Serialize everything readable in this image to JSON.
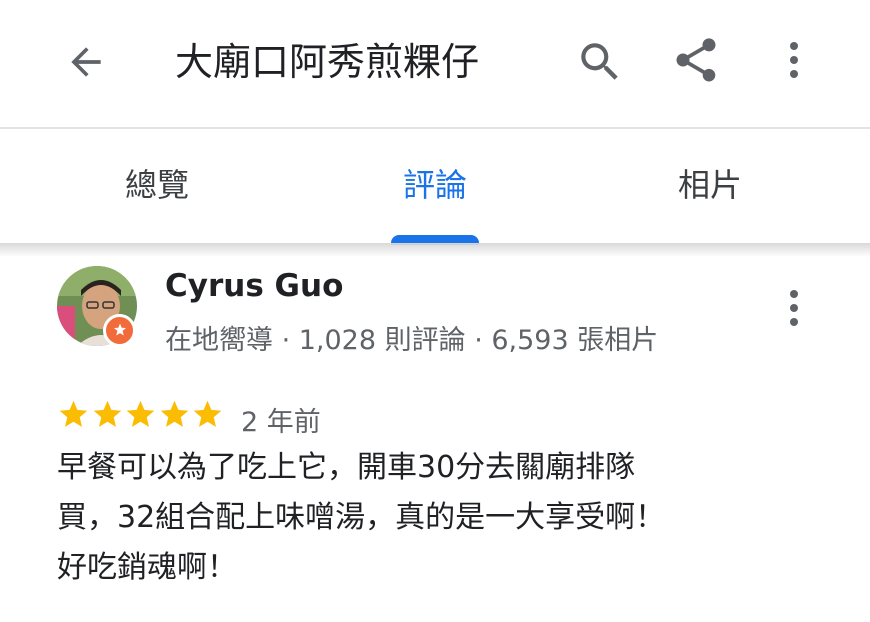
{
  "header": {
    "title": "大廟口阿秀煎粿仔",
    "back_icon": "arrow-back-icon",
    "search_icon": "search-icon",
    "share_icon": "share-icon",
    "more_icon": "more-vert-icon"
  },
  "tabs": [
    {
      "label": "總覽",
      "active": false
    },
    {
      "label": "評論",
      "active": true
    },
    {
      "label": "相片",
      "active": false
    }
  ],
  "review": {
    "author": "Cyrus Guo",
    "author_meta": "在地嚮導 · 1,028 則評論 · 6,593 張相片",
    "rating": 5,
    "rating_max": 5,
    "time_ago": "2 年前",
    "text_lines": [
      "早餐可以為了吃上它，開車30分去關廟排隊",
      "買，32組合配上味噌湯，真的是一大享受啊！",
      "好吃銷魂啊！"
    ]
  },
  "colors": {
    "accent": "#1a73e8",
    "star": "#fbbc04",
    "secondary_text": "#5f6368",
    "badge": "#f26b3a"
  }
}
